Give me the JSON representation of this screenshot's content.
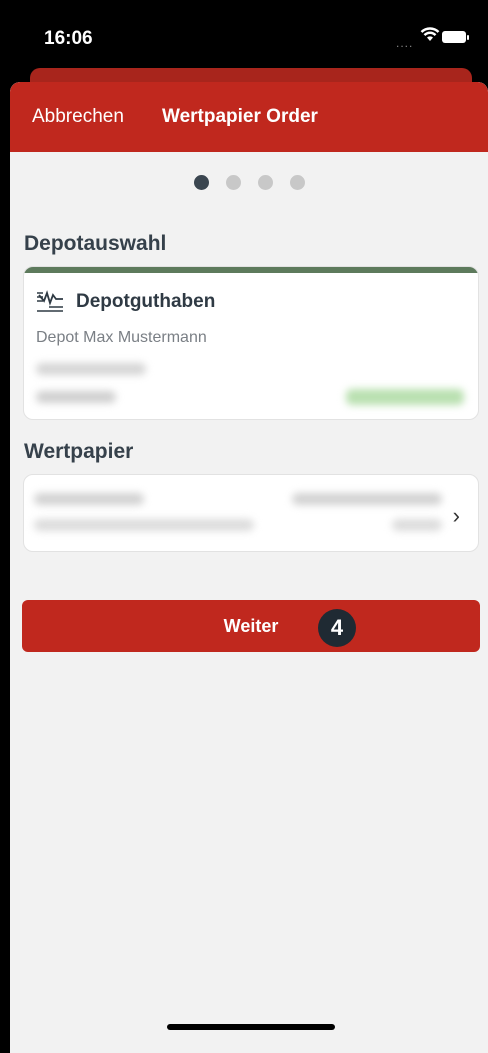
{
  "status_bar": {
    "time": "16:06",
    "signal": "....",
    "icons": [
      "wifi-icon",
      "battery-icon"
    ]
  },
  "nav": {
    "cancel_label": "Abbrechen",
    "title": "Wertpapier Order"
  },
  "steps": {
    "total": 4,
    "current": 1
  },
  "depot_section": {
    "label": "Depotauswahl",
    "card": {
      "icon": "depot-chart-icon",
      "name": "Depotguthaben",
      "owner": "Depot Max Mustermann"
    }
  },
  "security_section": {
    "label": "Wertpapier",
    "chevron": "›"
  },
  "continue_button": {
    "label": "Weiter",
    "badge": "4"
  },
  "colors": {
    "brand_red": "#c0281e",
    "dark_text": "#36414b",
    "accent_green": "#5d7a5c",
    "background": "#f2f2f2"
  }
}
